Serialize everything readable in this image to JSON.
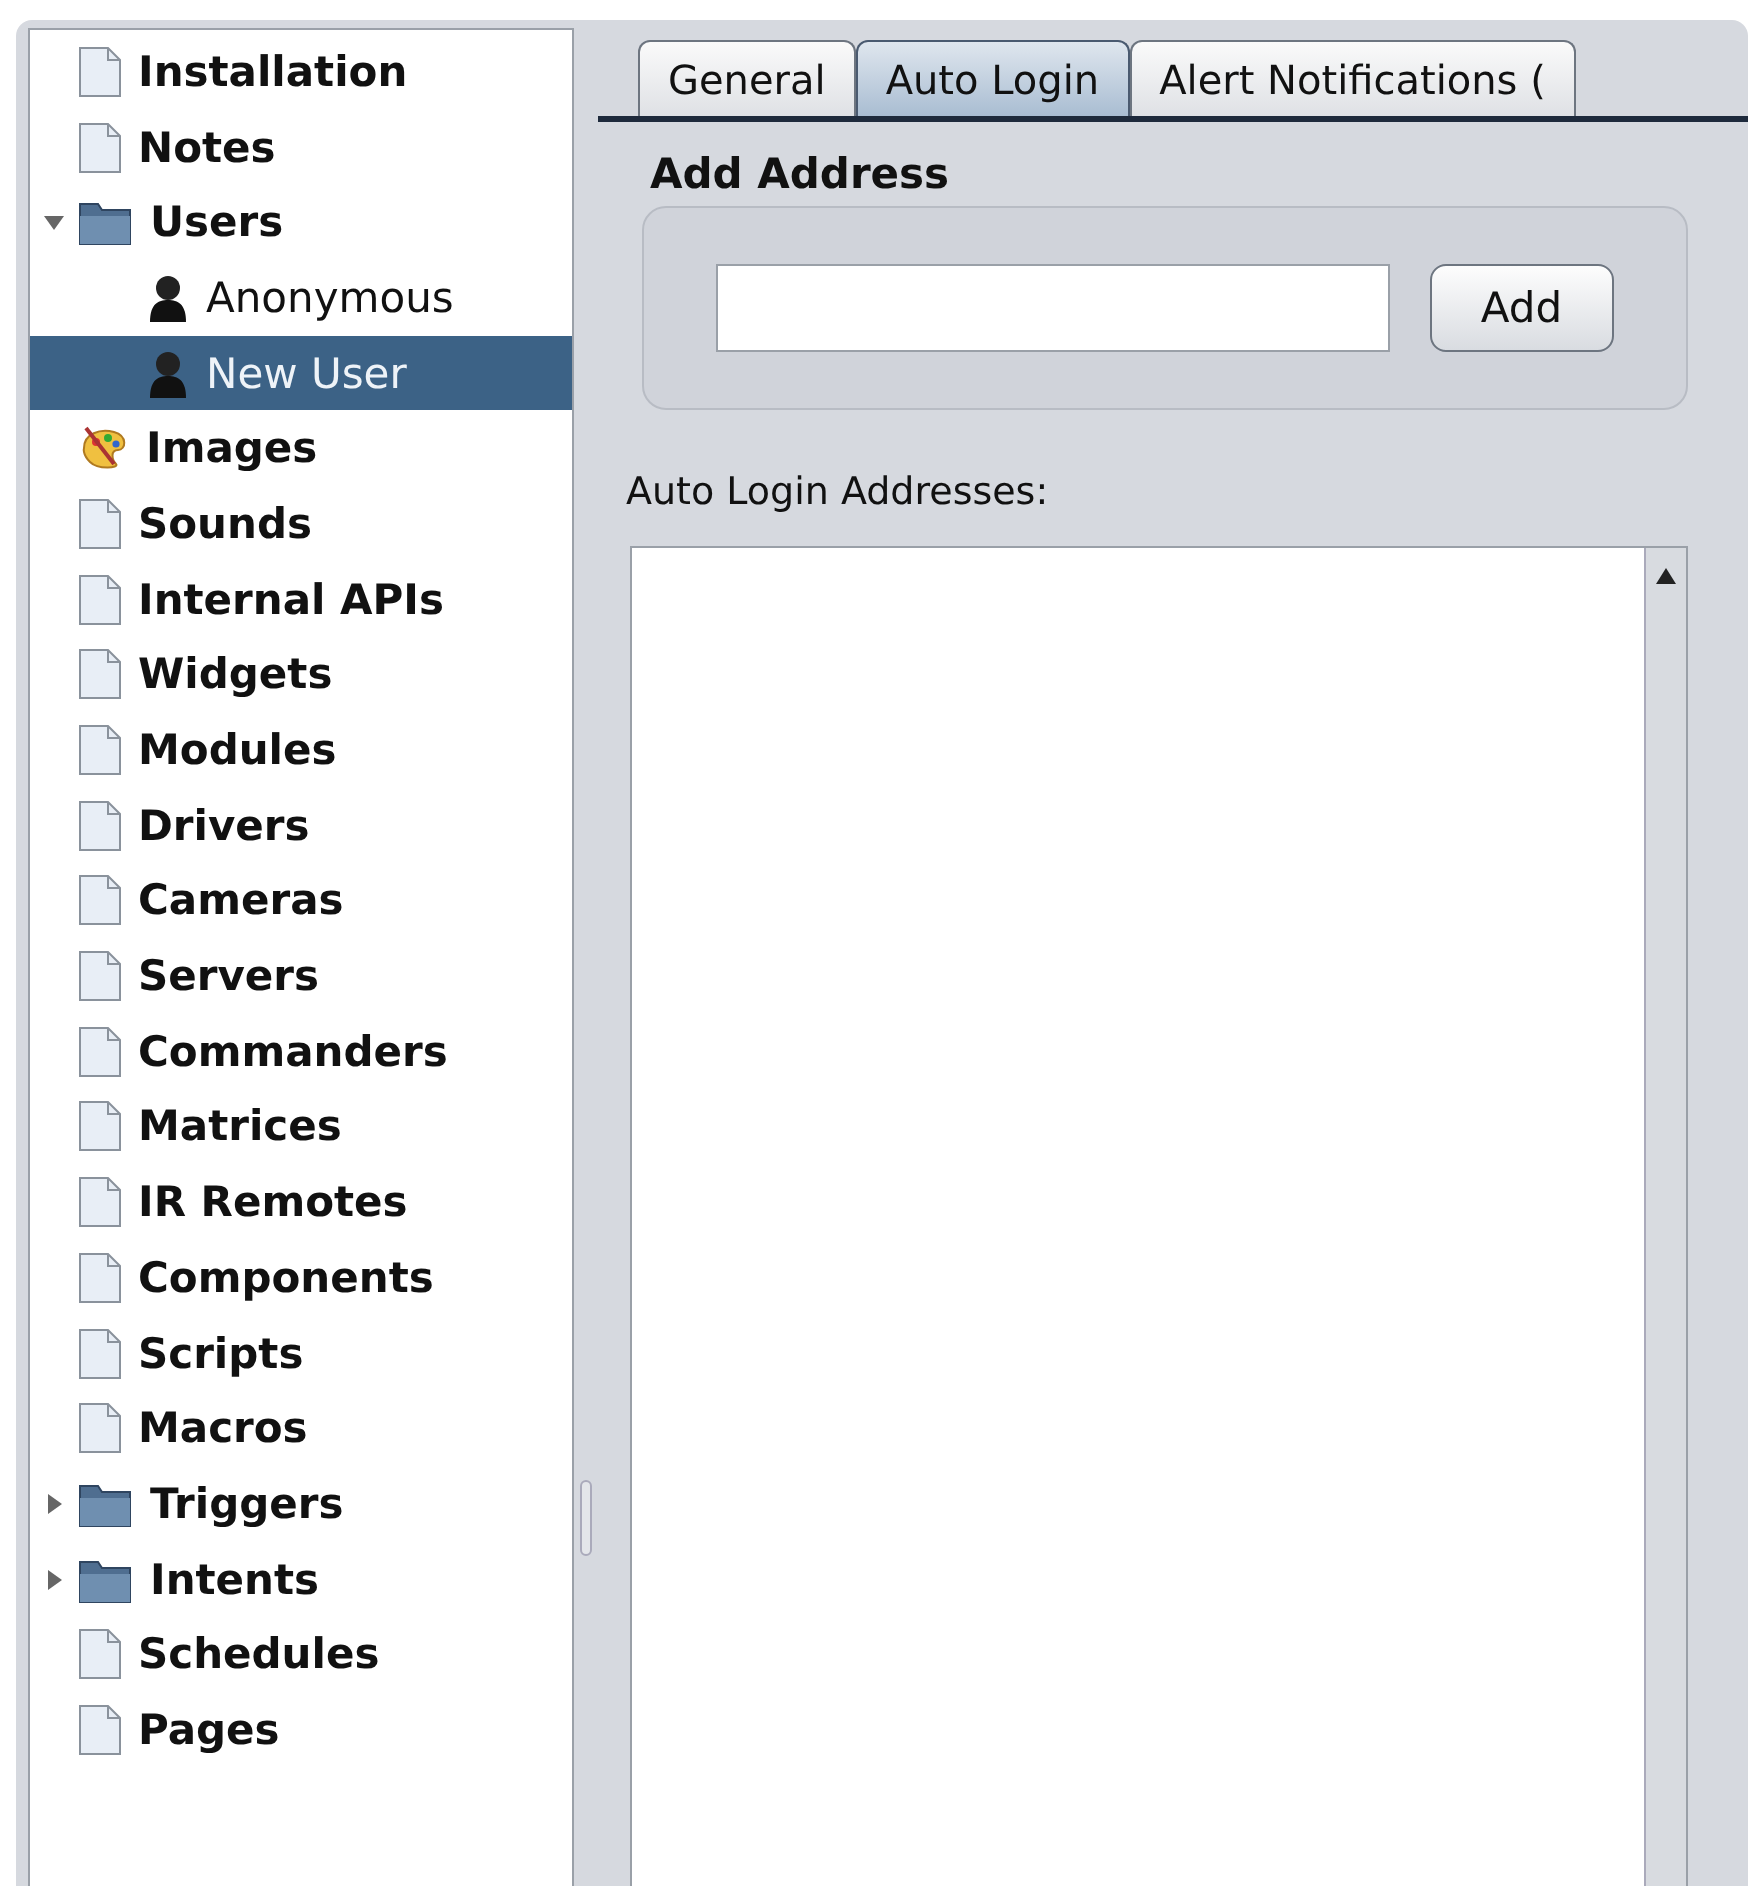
{
  "tree": [
    {
      "label": "Installation",
      "kind": "document"
    },
    {
      "label": "Notes",
      "kind": "document"
    },
    {
      "label": "Users",
      "kind": "folder",
      "expanded": true,
      "children": [
        {
          "label": "Anonymous",
          "kind": "user",
          "selected": false
        },
        {
          "label": "New User",
          "kind": "user",
          "selected": true
        }
      ]
    },
    {
      "label": "Images",
      "kind": "images"
    },
    {
      "label": "Sounds",
      "kind": "document"
    },
    {
      "label": "Internal APIs",
      "kind": "document"
    },
    {
      "label": "Widgets",
      "kind": "document"
    },
    {
      "label": "Modules",
      "kind": "document"
    },
    {
      "label": "Drivers",
      "kind": "document"
    },
    {
      "label": "Cameras",
      "kind": "document"
    },
    {
      "label": "Servers",
      "kind": "document"
    },
    {
      "label": "Commanders",
      "kind": "document"
    },
    {
      "label": "Matrices",
      "kind": "document"
    },
    {
      "label": "IR Remotes",
      "kind": "document"
    },
    {
      "label": "Components",
      "kind": "document"
    },
    {
      "label": "Scripts",
      "kind": "document"
    },
    {
      "label": "Macros",
      "kind": "document"
    },
    {
      "label": "Triggers",
      "kind": "folder",
      "expanded": false
    },
    {
      "label": "Intents",
      "kind": "folder",
      "expanded": false
    },
    {
      "label": "Schedules",
      "kind": "document"
    },
    {
      "label": "Pages",
      "kind": "document"
    }
  ],
  "tabs": [
    {
      "label": "General",
      "selected": false
    },
    {
      "label": "Auto Login",
      "selected": true
    },
    {
      "label": "Alert Notifications (",
      "selected": false
    }
  ],
  "add_address": {
    "title": "Add Address",
    "button": "Add"
  },
  "list": {
    "label": "Auto Login Addresses:"
  }
}
